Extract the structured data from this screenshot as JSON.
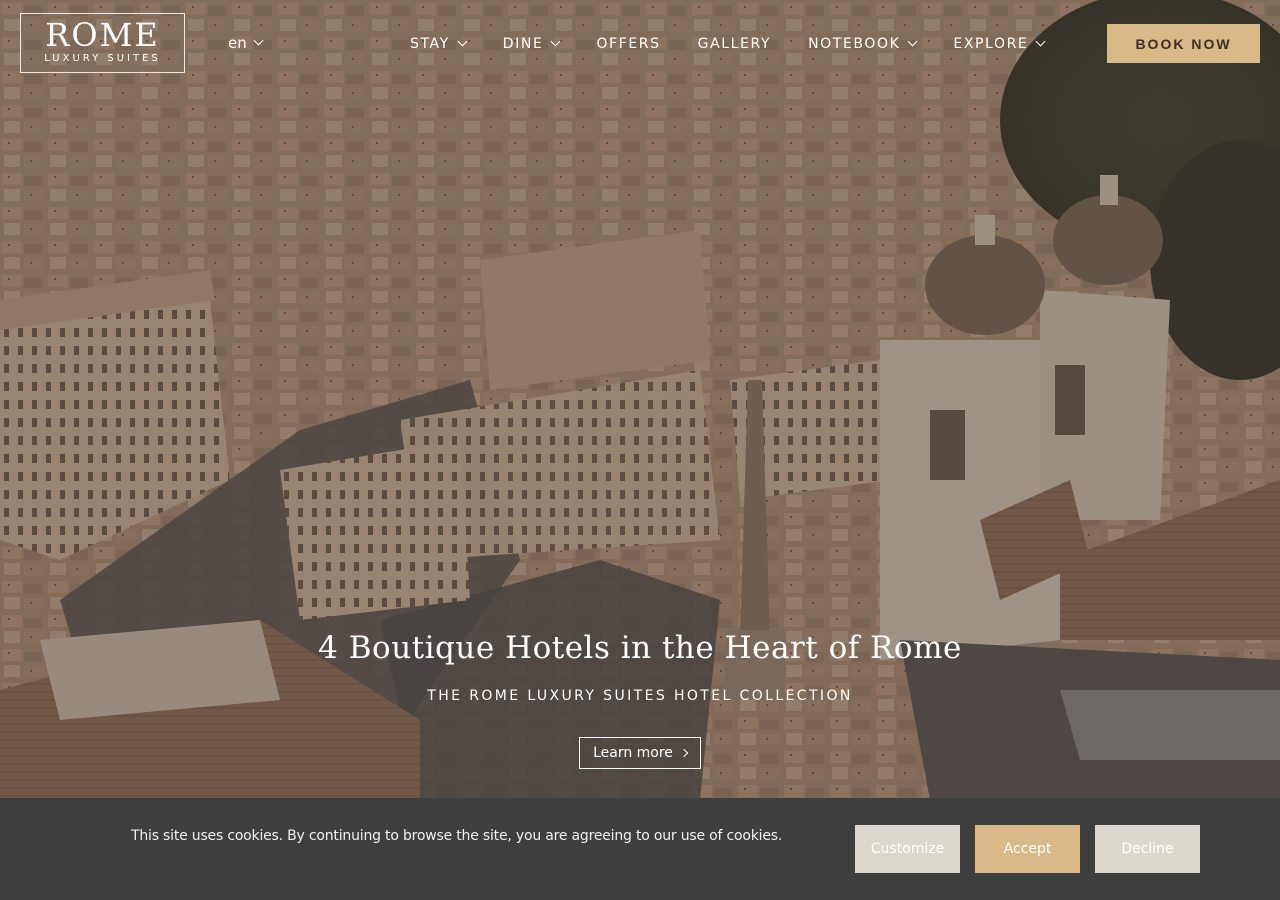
{
  "brand": {
    "logo_word": "ROME",
    "logo_sub": "LUXURY SUITES"
  },
  "language": {
    "current": "en"
  },
  "nav": {
    "items": [
      {
        "label": "STAY",
        "has_dropdown": true
      },
      {
        "label": "DINE",
        "has_dropdown": true
      },
      {
        "label": "OFFERS",
        "has_dropdown": false
      },
      {
        "label": "GALLERY",
        "has_dropdown": false
      },
      {
        "label": "NOTEBOOK",
        "has_dropdown": true
      },
      {
        "label": "EXPLORE",
        "has_dropdown": true
      }
    ],
    "book_label": "BOOK NOW"
  },
  "hero": {
    "headline": "4 Boutique Hotels in the Heart of Rome",
    "tagline": "THE ROME LUXURY SUITES HOTEL COLLECTION",
    "cta_label": "Learn more"
  },
  "cookie_bar": {
    "message": "This site uses cookies. By continuing to browse the site, you are agreeing to our use of cookies.",
    "customize_label": "Customize",
    "accept_label": "Accept",
    "decline_label": "Decline"
  },
  "colors": {
    "accent": "#d9b987",
    "cookie_bg": "#3f3f3f",
    "secondary_button": "#dcd7cc"
  }
}
